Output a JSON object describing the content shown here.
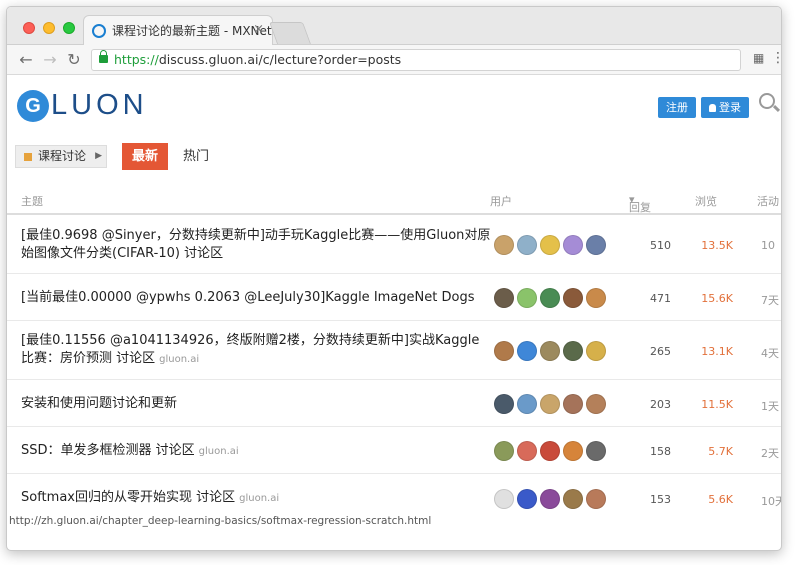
{
  "browser": {
    "tab_title": "课程讨论的最新主题 - MXNet / ",
    "tab_close": "×",
    "url_scheme": "https://",
    "url_rest": "discuss.gluon.ai/c/lecture?order=posts",
    "translate_icon": "translate-icon",
    "menu_icon": "⋮"
  },
  "site": {
    "logo_letter": "G",
    "logo_text": "LUON",
    "register_label": "注册",
    "login_label": "登录"
  },
  "nav": {
    "category": "课程讨论",
    "latest": "最新",
    "top": "热门"
  },
  "table": {
    "headers": {
      "topic": "主题",
      "users": "用户",
      "replies": "回复",
      "views": "浏览",
      "activity": "活动"
    },
    "rows": [
      {
        "title": "[最佳0.9698 @Sinyer，分数持续更新中]动手玩Kaggle比赛——使用Gluon对原始图像文件分类(CIFAR-10) 讨论区",
        "category": "",
        "replies": "510",
        "views": "13.5K",
        "activity": "10",
        "avatar_colors": [
          "#c9a26a",
          "#8fb0c9",
          "#e4c04a",
          "#a58cd6",
          "#6a7fa8",
          "#3d5fa8"
        ]
      },
      {
        "title": "[当前最佳0.00000 @ypwhs 0.2063 @LeeJuly30]Kaggle ImageNet Dogs",
        "category": "",
        "replies": "471",
        "views": "15.6K",
        "activity": "7天",
        "avatar_colors": [
          "#6b5d4a",
          "#8ac36a",
          "#4a8c54",
          "#8a5a3a",
          "#c98a4a",
          "#6a4a3a"
        ]
      },
      {
        "title": "[最佳0.11556 @a1041134926，终版附赠2楼，分数持续更新中]实战Kaggle比赛：房价预测 讨论区",
        "category": "gluon.ai",
        "replies": "265",
        "views": "13.1K",
        "activity": "4天",
        "avatar_colors": [
          "#b07a4a",
          "#3f87d8",
          "#9c8a5e",
          "#5a6a4a",
          "#d6b04a",
          "#7a6a5a"
        ]
      },
      {
        "title": "安装和使用问题讨论和更新",
        "category": "",
        "replies": "203",
        "views": "11.5K",
        "activity": "1天",
        "avatar_colors": [
          "#4a5a6a",
          "#6a9ac9",
          "#c9a56a",
          "#a5735a",
          "#b4805a",
          "#9a7a6a"
        ]
      },
      {
        "title": "SSD：单发多框检测器 讨论区",
        "category": "gluon.ai",
        "replies": "158",
        "views": "5.7K",
        "activity": "2天",
        "avatar_colors": [
          "#8a9a5a",
          "#d86a5a",
          "#c94a3a",
          "#d6843a",
          "#6a6a6a",
          "#4a6a8a"
        ]
      },
      {
        "title": "Softmax回归的从零开始实现 讨论区",
        "category": "gluon.ai",
        "replies": "153",
        "views": "5.6K",
        "activity": "10天",
        "avatar_colors": [
          "#e0e0e0",
          "#3a5ac9",
          "#8a4a9a",
          "#9a7a4a",
          "#b87a5a",
          "#c98a6a"
        ],
        "status_url": "http://zh.gluon.ai/chapter_deep-learning-basics/softmax-regression-scratch.html"
      }
    ]
  }
}
